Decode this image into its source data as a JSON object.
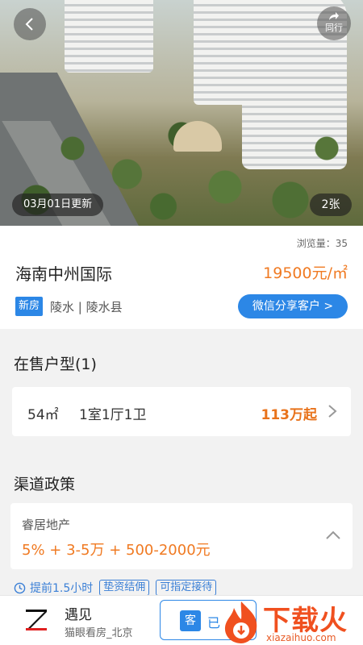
{
  "hero": {
    "back_icon": "chevron-left-icon",
    "share": {
      "icon": "share-arrow-icon",
      "label": "同行"
    },
    "update_label": "03月01日更新",
    "image_count": "2张"
  },
  "info": {
    "views": "浏览量：35",
    "name": "海南中州国际",
    "price": "19500元/㎡",
    "tag": "新房",
    "location": "陵水 | 陵水县",
    "wechat_button": "微信分享客户 >"
  },
  "units_section": {
    "title": "在售户型(1)",
    "items": [
      {
        "area": "54㎡",
        "layout": "1室1厅1卫",
        "price": "113万起"
      }
    ]
  },
  "policy_section": {
    "title": "渠道政策",
    "card": {
      "name": "睿居地产",
      "desc": "5% + 3-5万 + 500-2000元"
    },
    "tags": [
      "提前1.5小时",
      "垫资结佣",
      "可指定接待"
    ]
  },
  "bottom_bar": {
    "agent_name": "遇见",
    "agent_sub": "猫眼看房_北京",
    "contact_icon_text": "客",
    "contact_label": "已"
  },
  "watermark": {
    "title": "下载火",
    "url": "xiazaihuo.com"
  },
  "colors": {
    "accent_blue": "#2c87e6",
    "price_orange": "#f07a22",
    "watermark_red": "#f0501f"
  }
}
